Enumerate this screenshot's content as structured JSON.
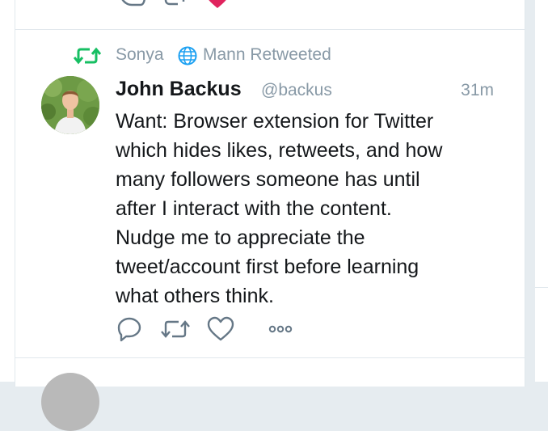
{
  "context": {
    "retweeter_first": "Sonya",
    "retweeter_rest": "Mann Retweeted"
  },
  "tweet": {
    "fullname": "John Backus",
    "username": "@backus",
    "time": "31m",
    "lines": [
      "Want: Browser extension for Twitter",
      "which hides likes, retweets, and how",
      "many followers someone has until",
      "after I interact with the content.",
      "Nudge me to appreciate the",
      "tweet/account first before learning",
      "what others think."
    ]
  },
  "icons": {
    "retweet_context": "retweet-icon",
    "globe": "globe-icon",
    "reply": "reply-icon",
    "retweet": "retweet-icon",
    "like": "heart-icon",
    "more": "more-icon"
  },
  "colors": {
    "retweet_green": "#17bf63",
    "like_red": "#e0245e",
    "muted_text": "#8899a6",
    "main_text": "#14171a",
    "action_gray": "#657786"
  }
}
